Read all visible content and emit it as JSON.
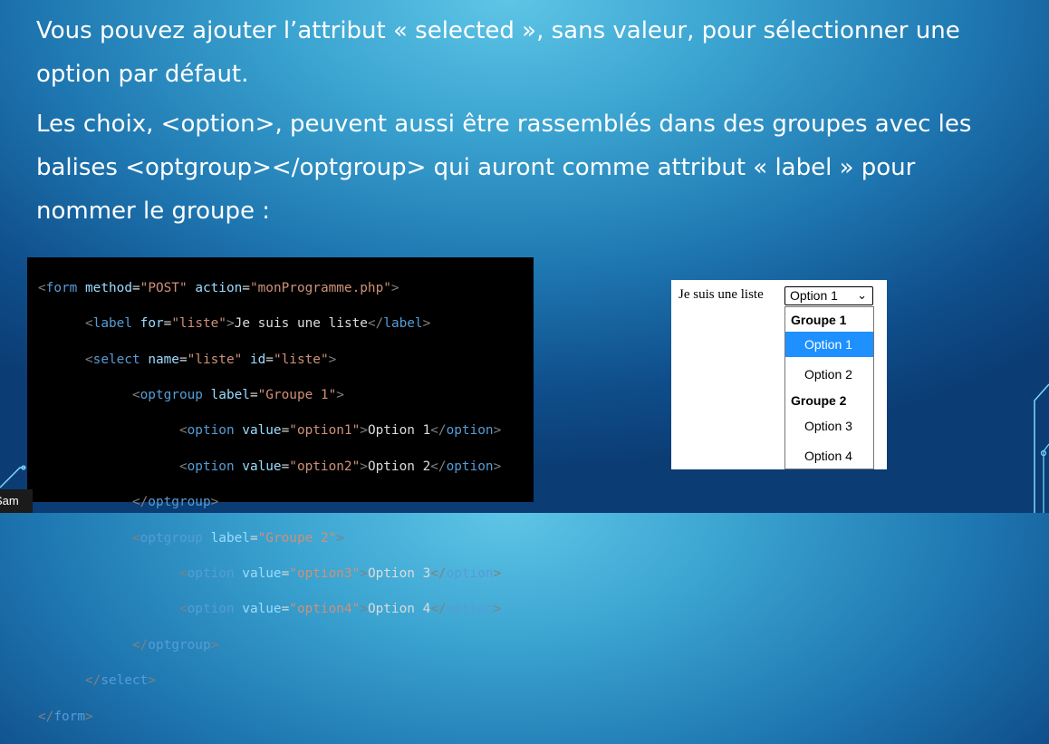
{
  "slide": {
    "paragraph1": "Vous pouvez ajouter l’attribut « selected », sans valeur, pour sélectionner une option par défaut.",
    "paragraph2": "Les choix, <option>, peuvent aussi être rassemblés dans des groupes avec les balises <optgroup></optgroup> qui auront comme attribut « label » pour nommer le groupe :"
  },
  "code": {
    "l1": {
      "tag": "form",
      "a1": "method",
      "v1": "\"POST\"",
      "a2": "action",
      "v2": "\"monProgramme.php\""
    },
    "l2": {
      "tag": "label",
      "a1": "for",
      "v1": "\"liste\"",
      "text": "Je suis une liste",
      "close": "label"
    },
    "l3": {
      "tag": "select",
      "a1": "name",
      "v1": "\"liste\"",
      "a2": "id",
      "v2": "\"liste\""
    },
    "l4": {
      "tag": "optgroup",
      "a1": "label",
      "v1": "\"Groupe 1\""
    },
    "l5": {
      "tag": "option",
      "a1": "value",
      "v1": "\"option1\"",
      "text": "Option 1",
      "close": "option"
    },
    "l6": {
      "tag": "option",
      "a1": "value",
      "v1": "\"option2\"",
      "text": "Option 2",
      "close": "option"
    },
    "l7": {
      "close": "optgroup"
    },
    "l8": {
      "tag": "optgroup",
      "a1": "label",
      "v1": "\"Groupe 2\""
    },
    "l9": {
      "tag": "option",
      "a1": "value",
      "v1": "\"option3\"",
      "text": "Option 3",
      "close": "option"
    },
    "l10": {
      "tag": "option",
      "a1": "value",
      "v1": "\"option4\"",
      "text": "Option 4",
      "close": "option"
    },
    "l11": {
      "close": "optgroup"
    },
    "l12": {
      "close": "select"
    },
    "l13": {
      "close": "form"
    }
  },
  "preview": {
    "label": "Je suis une liste",
    "selected": "Option 1",
    "groups": [
      {
        "label": "Groupe 1",
        "options": [
          "Option 1",
          "Option 2"
        ]
      },
      {
        "label": "Groupe 2",
        "options": [
          "Option 3",
          "Option 4"
        ]
      }
    ]
  },
  "presenter": {
    "name": "Sam"
  }
}
